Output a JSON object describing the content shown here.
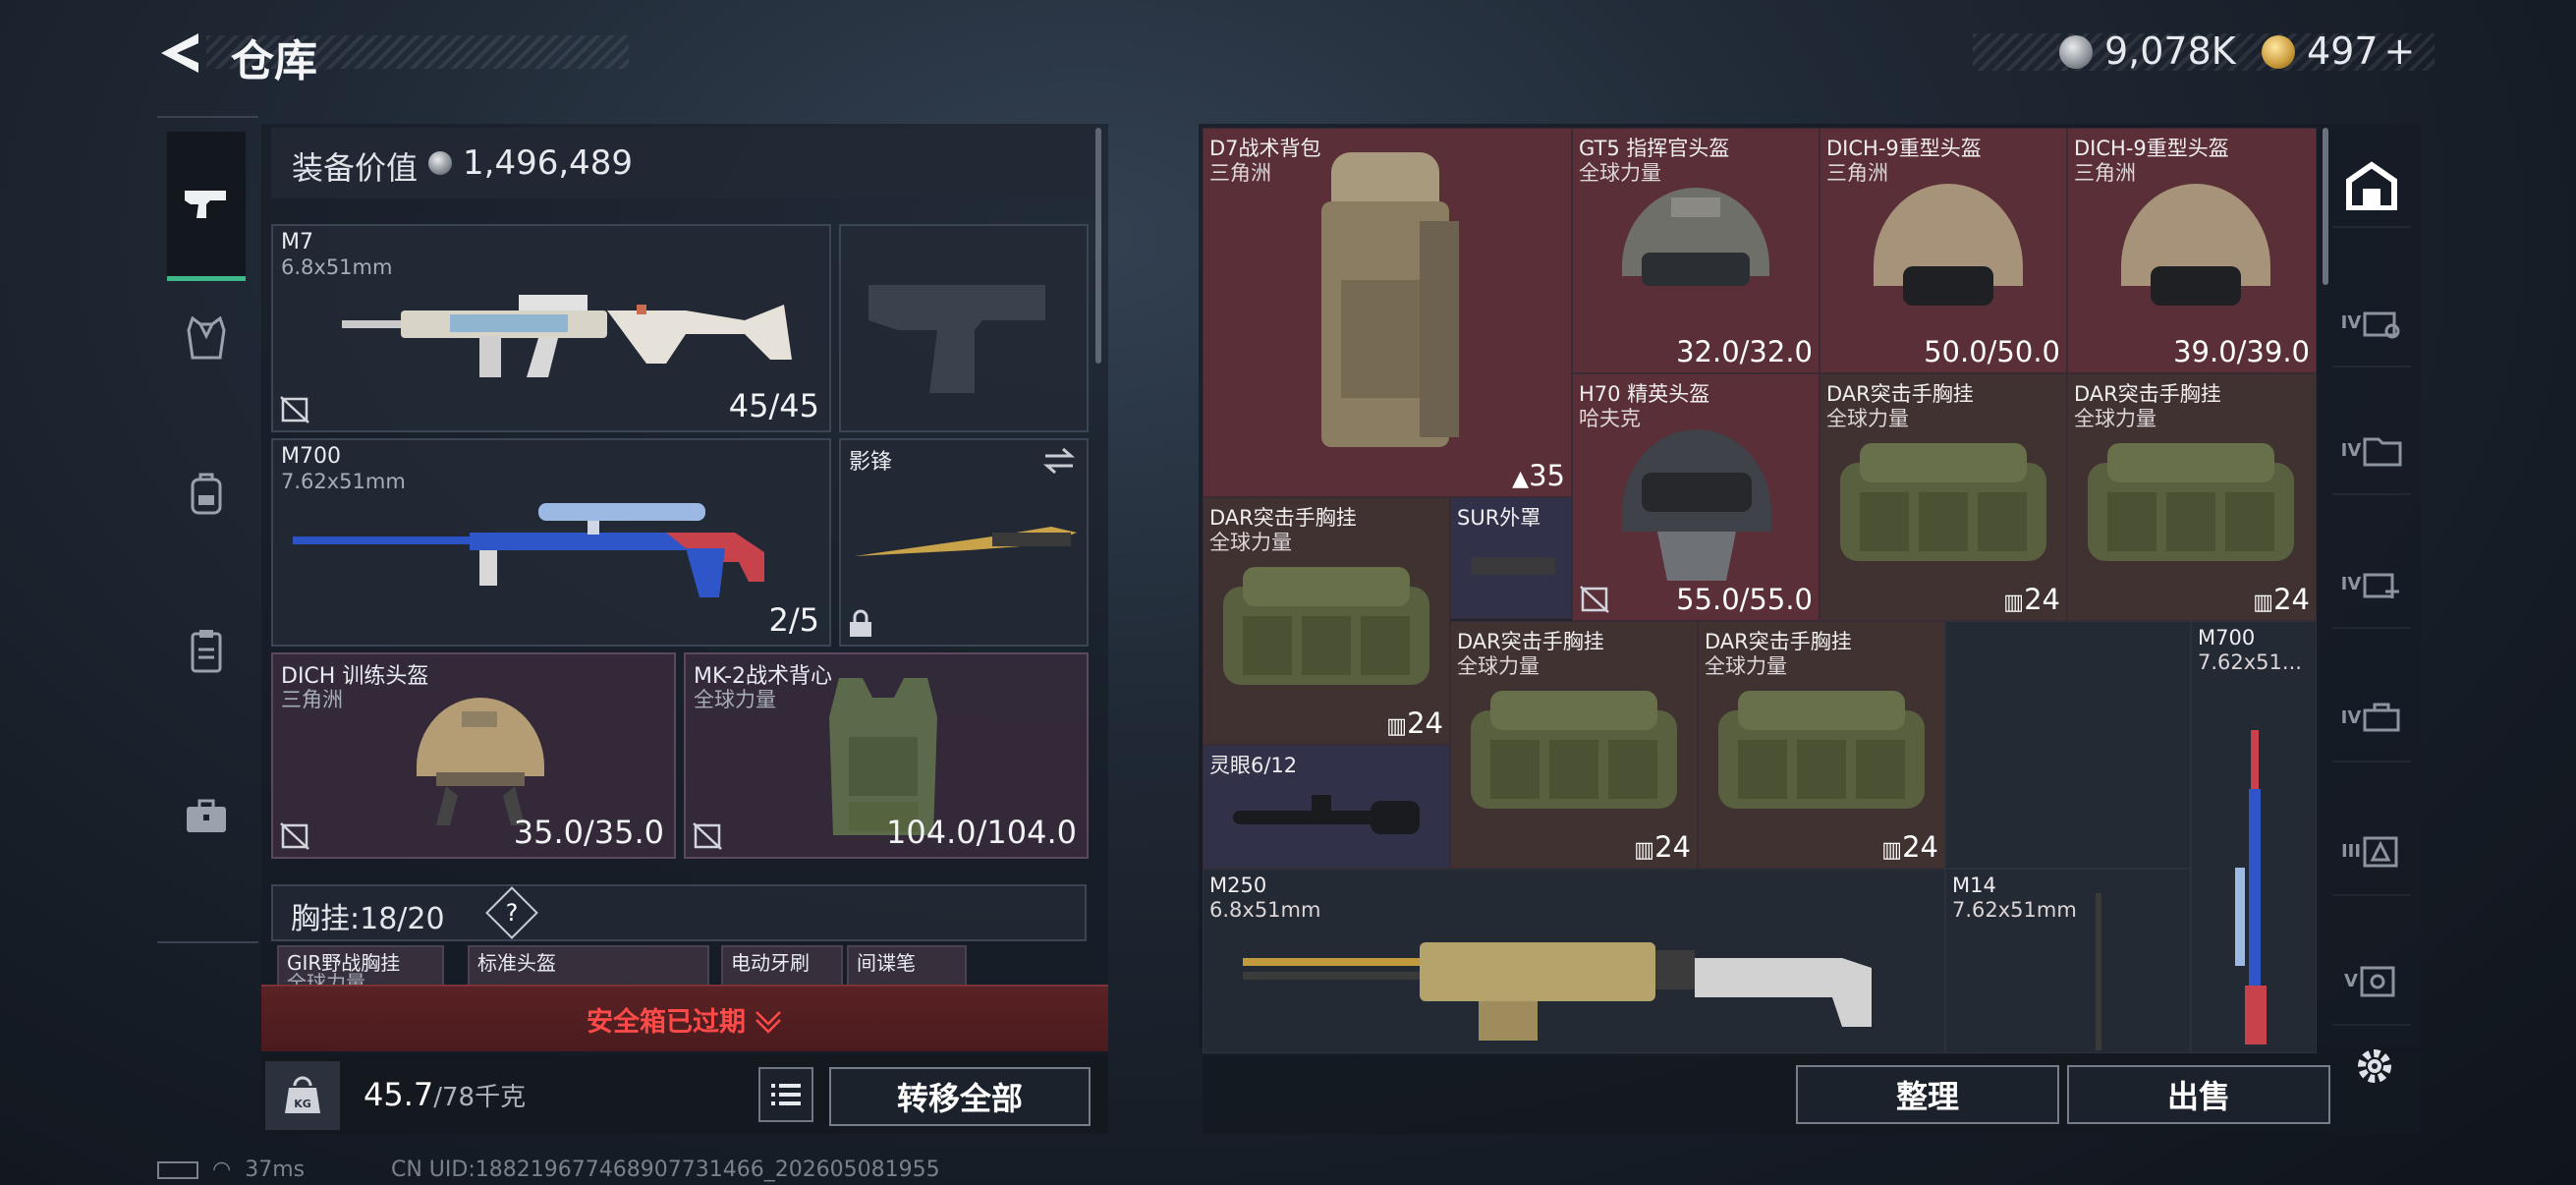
{
  "header": {
    "title": "仓库"
  },
  "currency": {
    "silver": "9,078K",
    "gold": "497",
    "gold_plus": "+"
  },
  "equipment": {
    "value_label": "装备价值",
    "value": "1,496,489",
    "primary": {
      "name": "M7",
      "caliber": "6.8x51mm",
      "ammo": "45/45"
    },
    "secondary": {
      "name": "M700",
      "caliber": "7.62x51mm",
      "ammo": "2/5"
    },
    "melee": {
      "name": "影锋"
    },
    "helmet": {
      "name": "DICH 训练头盔",
      "brand": "三角洲",
      "durability": "35.0/35.0"
    },
    "armor": {
      "name": "MK-2战术背心",
      "brand": "全球力量",
      "durability": "104.0/104.0"
    },
    "rig": {
      "label": "胸挂:",
      "used": "18",
      "capacity": "20",
      "help": "?"
    },
    "rig_items": [
      "GIR野战胸挂",
      "标准头盔",
      "电动牙刷",
      "间谍笔"
    ],
    "rig_item_sub": "全球力量"
  },
  "safe_box": {
    "expired_text": "安全箱已过期"
  },
  "weight": {
    "current": "45.7",
    "max": "/78千克",
    "icon_label": "KG"
  },
  "actions": {
    "transfer_all": "转移全部",
    "sort": "整理",
    "sell": "出售"
  },
  "stash": {
    "items": [
      {
        "name": "D7战术背包",
        "sub": "三角洲",
        "value": "35"
      },
      {
        "name": "GT5 指挥官头盔",
        "sub": "全球力量",
        "value": "32.0/32.0"
      },
      {
        "name": "DICH-9重型头盔",
        "sub": "三角洲",
        "value": "50.0/50.0"
      },
      {
        "name": "DICH-9重型头盔",
        "sub": "三角洲",
        "value": "39.0/39.0"
      },
      {
        "name": "H70 精英头盔",
        "sub": "哈夫克",
        "value": "55.0/55.0"
      },
      {
        "name": "DAR突击手胸挂",
        "sub": "全球力量",
        "value": "24"
      },
      {
        "name": "DAR突击手胸挂",
        "sub": "全球力量",
        "value": "24"
      },
      {
        "name": "DAR突击手胸挂",
        "sub": "全球力量",
        "value": "24"
      },
      {
        "name": "SUR外罩",
        "sub": "",
        "value": ""
      },
      {
        "name": "DAR突击手胸挂",
        "sub": "全球力量",
        "value": "24"
      },
      {
        "name": "DAR突击手胸挂",
        "sub": "全球力量",
        "value": "24"
      },
      {
        "name": "M700",
        "sub": "7.62x51...",
        "value": ""
      },
      {
        "name": "灵眼6/12",
        "sub": "",
        "value": ""
      },
      {
        "name": "M250",
        "sub": "6.8x51mm",
        "value": ""
      },
      {
        "name": "M14",
        "sub": "7.62x51mm",
        "value": ""
      }
    ]
  },
  "right_nav": [
    "IV",
    "IV",
    "IV",
    "IV",
    "III",
    "V"
  ],
  "status": {
    "ping": "37ms",
    "uid": "CN UID:18821967746890773​1466_202605081955"
  },
  "colors": {
    "accent_green": "#3fb889",
    "warning_red": "#ff4a4a",
    "gold": "#c99a3a"
  }
}
